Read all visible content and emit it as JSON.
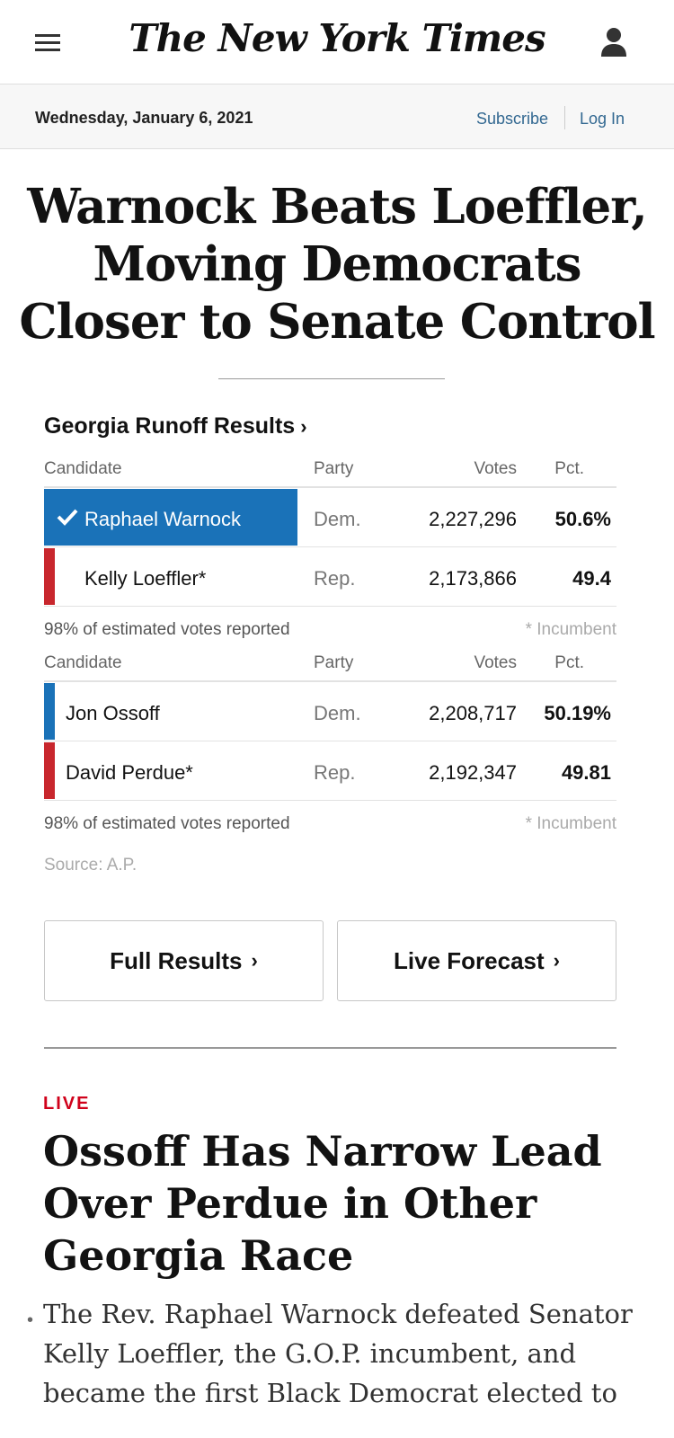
{
  "header": {
    "masthead": "The New York Times",
    "menu_icon": "hamburger-menu-icon",
    "account_icon": "user-icon"
  },
  "datebar": {
    "date": "Wednesday, January 6, 2021",
    "subscribe": "Subscribe",
    "login": "Log In"
  },
  "headline": "Warnock Beats Loeffler, Moving Democrats Closer to Senate Control",
  "results": {
    "title": "Georgia Runoff Results",
    "chevron": "›",
    "columns": {
      "candidate": "Candidate",
      "party": "Party",
      "votes": "Votes",
      "pct": "Pct."
    },
    "race1": {
      "rows": [
        {
          "name": "Raphael Warnock",
          "party": "Dem.",
          "votes": "2,227,296",
          "pct": "50.6%",
          "winner": true,
          "color": "#1a72b8"
        },
        {
          "name": "Kelly Loeffler*",
          "party": "Rep.",
          "votes": "2,173,866",
          "pct": "49.4",
          "winner": false,
          "color": "#c8272d"
        }
      ],
      "reported": "98% of estimated votes reported",
      "incumbent_note": "* Incumbent"
    },
    "race2": {
      "rows": [
        {
          "name": "Jon Ossoff",
          "party": "Dem.",
          "votes": "2,208,717",
          "pct": "50.19%",
          "color": "#1a72b8"
        },
        {
          "name": "David Perdue*",
          "party": "Rep.",
          "votes": "2,192,347",
          "pct": "49.81",
          "color": "#c8272d"
        }
      ],
      "reported": "98% of estimated votes reported",
      "incumbent_note": "* Incumbent"
    },
    "source": "Source: A.P."
  },
  "buttons": {
    "full_results": "Full Results",
    "live_forecast": "Live Forecast",
    "chevron": "›"
  },
  "story": {
    "label": "LIVE",
    "headline": "Ossoff Has Narrow Lead Over Perdue in Other Georgia Race",
    "bullet": "•",
    "summary": "The Rev. Raphael Warnock defeated Senator Kelly Loeffler, the G.O.P. incumbent, and became the first Black Democrat elected to"
  }
}
